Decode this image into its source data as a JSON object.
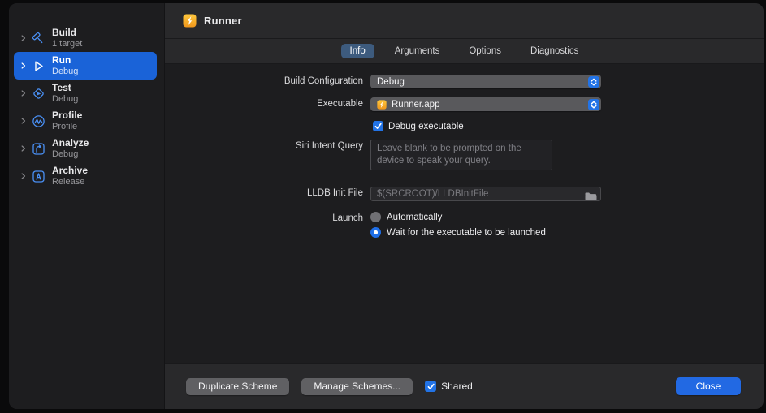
{
  "header": {
    "scheme_name": "Runner"
  },
  "sidebar": {
    "items": [
      {
        "label": "Build",
        "subtitle": "1 target",
        "icon": "hammer-icon",
        "selected": false
      },
      {
        "label": "Run",
        "subtitle": "Debug",
        "icon": "play-icon",
        "selected": true
      },
      {
        "label": "Test",
        "subtitle": "Debug",
        "icon": "test-diamond-icon",
        "selected": false
      },
      {
        "label": "Profile",
        "subtitle": "Profile",
        "icon": "profile-gauge-icon",
        "selected": false
      },
      {
        "label": "Analyze",
        "subtitle": "Debug",
        "icon": "analyze-icon",
        "selected": false
      },
      {
        "label": "Archive",
        "subtitle": "Release",
        "icon": "archive-icon",
        "selected": false
      }
    ]
  },
  "tabs": [
    {
      "label": "Info",
      "selected": true
    },
    {
      "label": "Arguments",
      "selected": false
    },
    {
      "label": "Options",
      "selected": false
    },
    {
      "label": "Diagnostics",
      "selected": false
    }
  ],
  "form": {
    "build_configuration": {
      "label": "Build Configuration",
      "value": "Debug"
    },
    "executable": {
      "label": "Executable",
      "value": "Runner.app",
      "icon": "runner-app-icon"
    },
    "debug_executable": {
      "label": "Debug executable",
      "checked": true
    },
    "siri_intent_query": {
      "label": "Siri Intent Query",
      "placeholder": "Leave blank to be prompted on the device to speak your query."
    },
    "lldb_init_file": {
      "label": "LLDB Init File",
      "placeholder": "$(SRCROOT)/LLDBInitFile",
      "value": ""
    },
    "launch": {
      "label": "Launch",
      "options": [
        {
          "label": "Automatically",
          "selected": false
        },
        {
          "label": "Wait for the executable to be launched",
          "selected": true
        }
      ]
    }
  },
  "footer": {
    "duplicate_label": "Duplicate Scheme",
    "manage_label": "Manage Schemes...",
    "shared_checkbox": {
      "label": "Shared",
      "checked": true
    },
    "close_label": "Close"
  },
  "colors": {
    "accent_blue": "#2273e6",
    "selection_blue": "#1a63d8",
    "tab_pill_blue": "#3d5b7e",
    "app_icon_amber": "#f6a623",
    "panel_dark": "#1d1d1f",
    "band_gray": "#29292b"
  }
}
